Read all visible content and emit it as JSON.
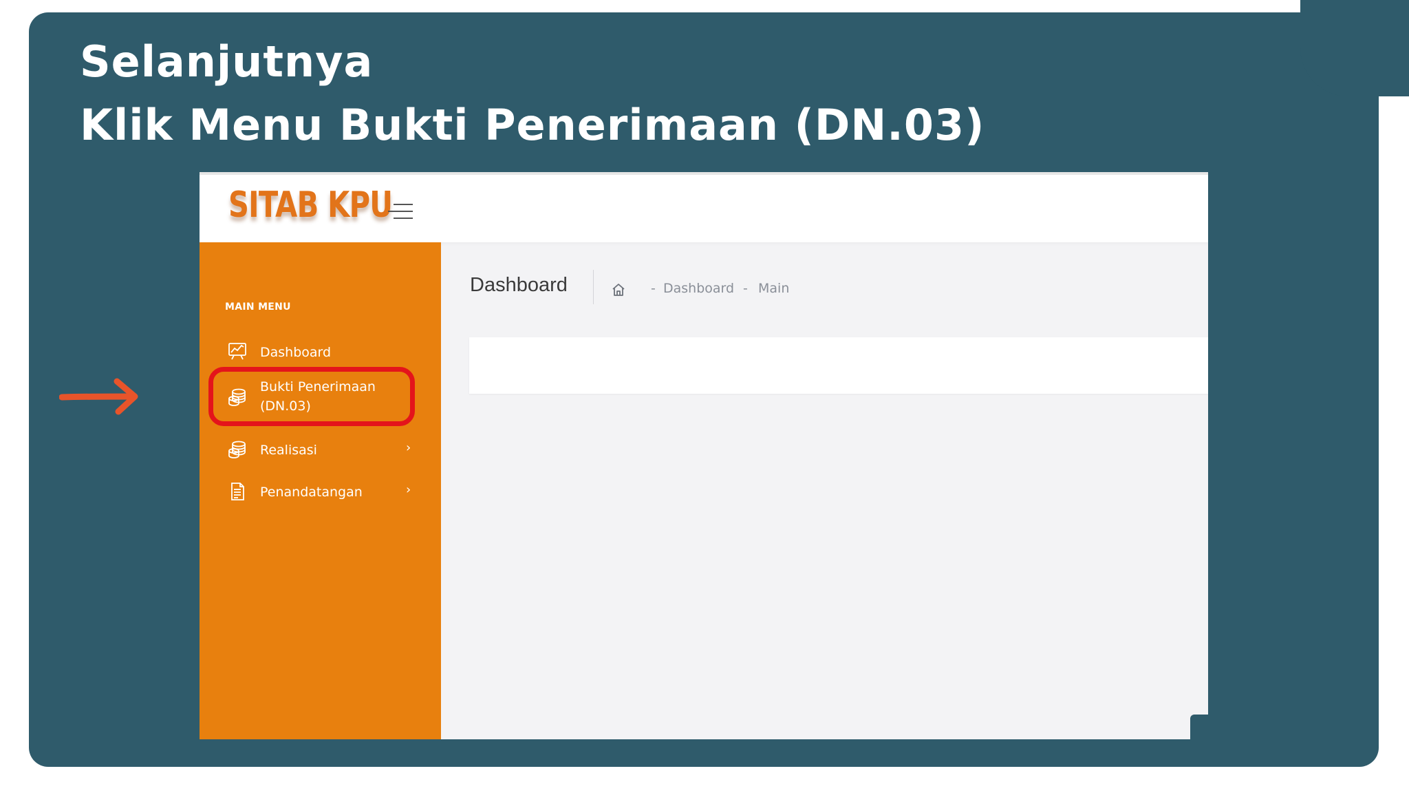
{
  "slide": {
    "title_line1": "Selanjutnya",
    "title_line2": "Klik Menu Bukti Penerimaan (DN.03)",
    "background_color": "#2f5b6b",
    "arrow_color": "#e8542a",
    "highlight_color": "#e4141b"
  },
  "app": {
    "logo": "SITAB KPU",
    "accent_color": "#e8800e",
    "sidebar": {
      "heading": "MAIN MENU",
      "items": [
        {
          "label": "Dashboard",
          "icon": "chart-board-icon"
        },
        {
          "label_line1": "Bukti Penerimaan",
          "label_line2": "(DN.03)",
          "icon": "coin-stack-icon",
          "highlighted": true
        },
        {
          "label": "Realisasi",
          "icon": "coin-stack-icon",
          "chevron": "›"
        },
        {
          "label": "Penandatangan",
          "icon": "document-icon",
          "chevron": "›"
        }
      ]
    },
    "page": {
      "title": "Dashboard",
      "breadcrumb": {
        "home_icon": "home-icon",
        "separator": "-",
        "items": [
          "Dashboard",
          "Main"
        ]
      }
    }
  }
}
